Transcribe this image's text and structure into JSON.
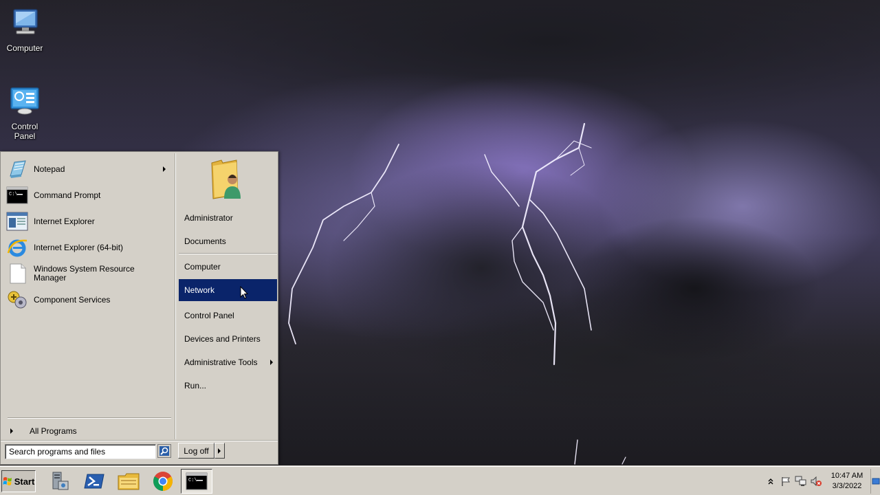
{
  "desktop": {
    "icons": [
      {
        "label": "Computer",
        "icon": "computer-icon"
      },
      {
        "label": "Control Panel",
        "icon": "control-panel-icon"
      }
    ]
  },
  "start_menu": {
    "programs": [
      {
        "label": "Notepad",
        "icon": "notepad-icon",
        "submenu": true
      },
      {
        "label": "Command Prompt",
        "icon": "command-prompt-icon"
      },
      {
        "label": "Internet Explorer",
        "icon": "internet-explorer-window-icon"
      },
      {
        "label": "Internet Explorer (64-bit)",
        "icon": "internet-explorer-icon"
      },
      {
        "label": "Windows System Resource Manager",
        "icon": "document-icon"
      },
      {
        "label": "Component Services",
        "icon": "component-services-icon"
      }
    ],
    "all_programs": "All Programs",
    "places": [
      {
        "label": "Administrator"
      },
      {
        "label": "Documents"
      },
      {
        "label": "Computer"
      },
      {
        "label": "Network",
        "highlighted": true
      },
      {
        "label": "Control Panel"
      },
      {
        "label": "Devices and Printers"
      },
      {
        "label": "Administrative Tools",
        "submenu": true
      },
      {
        "label": "Run..."
      }
    ],
    "search_placeholder": "Search programs and files",
    "logoff_label": "Log off"
  },
  "taskbar": {
    "start_label": "Start",
    "pinned": [
      {
        "name": "server-manager-icon"
      },
      {
        "name": "powershell-icon"
      },
      {
        "name": "explorer-folder-icon"
      },
      {
        "name": "chrome-icon"
      },
      {
        "name": "command-prompt-icon",
        "active": true
      }
    ],
    "tray_icons": [
      "show-hidden-icons",
      "action-center-flag-icon",
      "network-icon",
      "volume-muted-icon"
    ],
    "clock": {
      "time": "10:47 AM",
      "date": "3/3/2022"
    }
  },
  "colors": {
    "menu_bg": "#d4d0c8",
    "highlight": "#0a246a"
  }
}
